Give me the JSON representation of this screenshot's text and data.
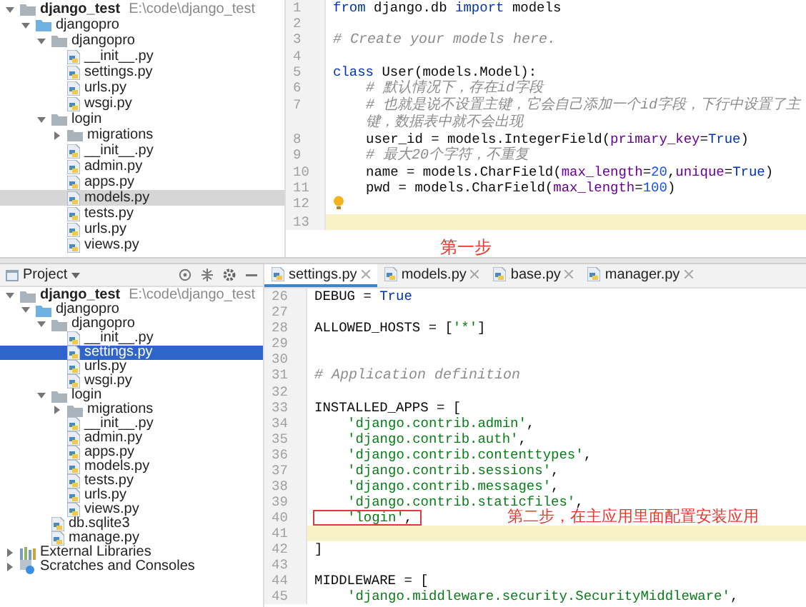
{
  "top": {
    "tree": [
      {
        "label": "django_test",
        "path": "E:\\code\\django_test",
        "kind": "root",
        "expanded": true,
        "selected": false,
        "children": [
          {
            "label": "djangopro",
            "kind": "module",
            "expanded": true,
            "selected": false,
            "children": [
              {
                "label": "djangopro",
                "kind": "folder",
                "expanded": true,
                "selected": false,
                "children": [
                  {
                    "label": "__init__.py",
                    "kind": "file",
                    "selected": false
                  },
                  {
                    "label": "settings.py",
                    "kind": "file",
                    "selected": false
                  },
                  {
                    "label": "urls.py",
                    "kind": "file",
                    "selected": false
                  },
                  {
                    "label": "wsgi.py",
                    "kind": "file",
                    "selected": false
                  }
                ]
              },
              {
                "label": "login",
                "kind": "folder",
                "expanded": true,
                "selected": false,
                "children": [
                  {
                    "label": "migrations",
                    "kind": "folder",
                    "expanded": false,
                    "selected": false
                  },
                  {
                    "label": "__init__.py",
                    "kind": "file",
                    "selected": false
                  },
                  {
                    "label": "admin.py",
                    "kind": "file",
                    "selected": false
                  },
                  {
                    "label": "apps.py",
                    "kind": "file",
                    "selected": false
                  },
                  {
                    "label": "models.py",
                    "kind": "file",
                    "selected": true
                  },
                  {
                    "label": "tests.py",
                    "kind": "file",
                    "selected": false
                  },
                  {
                    "label": "urls.py",
                    "kind": "file",
                    "selected": false
                  },
                  {
                    "label": "views.py",
                    "kind": "file",
                    "selected": false
                  }
                ]
              }
            ]
          }
        ]
      }
    ],
    "editor": {
      "lines": [
        {
          "number": "1",
          "current": false,
          "bulb": false,
          "indented": false,
          "tokens": [
            {
              "kind": "keyword",
              "text": "from"
            },
            {
              "kind": "plain",
              "text": " django.db "
            },
            {
              "kind": "keyword",
              "text": "import"
            },
            {
              "kind": "plain",
              "text": " models"
            }
          ]
        },
        {
          "number": "2",
          "current": false,
          "bulb": false
        },
        {
          "number": "3",
          "current": false,
          "bulb": false,
          "indented": false,
          "tokens": [
            {
              "kind": "comment",
              "text": "# Create your models here."
            }
          ]
        },
        {
          "number": "4",
          "current": false,
          "bulb": false
        },
        {
          "number": "5",
          "current": false,
          "bulb": false,
          "indented": false,
          "tokens": [
            {
              "kind": "keyword",
              "text": "class"
            },
            {
              "kind": "plain",
              "text": " User(models.Model):"
            }
          ]
        },
        {
          "number": "6",
          "current": false,
          "bulb": false,
          "indented": true,
          "tokens": [
            {
              "kind": "comment",
              "text": "# 默认情况下，存在id字段"
            }
          ]
        },
        {
          "number": "7",
          "current": false,
          "bulb": false,
          "indented": true,
          "tokens": [
            {
              "kind": "comment",
              "text": "# 也就是说不设置主键，它会自己添加一个id字段，下行中设置了主键，数据表中就不会出现"
            }
          ]
        },
        {
          "number": "8",
          "current": false,
          "bulb": false,
          "indented": true,
          "tokens": [
            {
              "kind": "plain",
              "text": "user_id = models.IntegerField("
            },
            {
              "kind": "param",
              "text": "primary_key"
            },
            {
              "kind": "plain",
              "text": "="
            },
            {
              "kind": "bool",
              "text": "True"
            },
            {
              "kind": "plain",
              "text": ")"
            }
          ]
        },
        {
          "number": "9",
          "current": false,
          "bulb": false,
          "indented": true,
          "tokens": [
            {
              "kind": "comment",
              "text": "# 最大20个字符，不重复"
            }
          ]
        },
        {
          "number": "10",
          "current": false,
          "bulb": false,
          "indented": true,
          "tokens": [
            {
              "kind": "plain",
              "text": "name = models.CharField("
            },
            {
              "kind": "param",
              "text": "max_length"
            },
            {
              "kind": "plain",
              "text": "="
            },
            {
              "kind": "number",
              "text": "20"
            },
            {
              "kind": "plain",
              "text": ","
            },
            {
              "kind": "param",
              "text": "unique"
            },
            {
              "kind": "plain",
              "text": "="
            },
            {
              "kind": "bool",
              "text": "True"
            },
            {
              "kind": "plain",
              "text": ")"
            }
          ]
        },
        {
          "number": "11",
          "current": false,
          "bulb": false,
          "indented": true,
          "tokens": [
            {
              "kind": "plain",
              "text": "pwd = models.CharField("
            },
            {
              "kind": "param",
              "text": "max_length"
            },
            {
              "kind": "plain",
              "text": "="
            },
            {
              "kind": "number",
              "text": "100"
            },
            {
              "kind": "plain",
              "text": ")"
            }
          ]
        },
        {
          "number": "12",
          "current": false,
          "bulb": true
        },
        {
          "number": "13",
          "current": true,
          "bulb": false
        }
      ],
      "annotation": "第一步"
    }
  },
  "bottom": {
    "panel_title": "Project",
    "tree": [
      {
        "label": "django_test",
        "path": "E:\\code\\django_test",
        "kind": "root",
        "expanded": true,
        "selected": false,
        "children": [
          {
            "label": "djangopro",
            "kind": "module",
            "expanded": true,
            "selected": false,
            "children": [
              {
                "label": "djangopro",
                "kind": "folder",
                "expanded": true,
                "selected": false,
                "children": [
                  {
                    "label": "__init__.py",
                    "kind": "file",
                    "selected": false
                  },
                  {
                    "label": "settings.py",
                    "kind": "file",
                    "selected": true
                  },
                  {
                    "label": "urls.py",
                    "kind": "file",
                    "selected": false
                  },
                  {
                    "label": "wsgi.py",
                    "kind": "file",
                    "selected": false
                  }
                ]
              },
              {
                "label": "login",
                "kind": "folder",
                "expanded": true,
                "selected": false,
                "children": [
                  {
                    "label": "migrations",
                    "kind": "folder",
                    "expanded": false,
                    "selected": false
                  },
                  {
                    "label": "__init__.py",
                    "kind": "file",
                    "selected": false
                  },
                  {
                    "label": "admin.py",
                    "kind": "file",
                    "selected": false
                  },
                  {
                    "label": "apps.py",
                    "kind": "file",
                    "selected": false
                  },
                  {
                    "label": "models.py",
                    "kind": "file",
                    "selected": false
                  },
                  {
                    "label": "tests.py",
                    "kind": "file",
                    "selected": false
                  },
                  {
                    "label": "urls.py",
                    "kind": "file",
                    "selected": false
                  },
                  {
                    "label": "views.py",
                    "kind": "file",
                    "selected": false
                  }
                ]
              },
              {
                "label": "db.sqlite3",
                "kind": "file",
                "selected": false
              },
              {
                "label": "manage.py",
                "kind": "file",
                "selected": false
              }
            ]
          }
        ]
      },
      {
        "label": "External Libraries",
        "kind": "library",
        "expanded": false,
        "selected": false
      },
      {
        "label": "Scratches and Consoles",
        "kind": "scratches",
        "expanded": false,
        "selected": false
      }
    ],
    "tabs": [
      {
        "label": "settings.py",
        "selected": true
      },
      {
        "label": "models.py",
        "selected": false
      },
      {
        "label": "base.py",
        "selected": false
      },
      {
        "label": "manager.py",
        "selected": false
      }
    ],
    "editor": {
      "lines": [
        {
          "number": "26",
          "current": false,
          "boxed": false,
          "indented": false,
          "tokens": [
            {
              "kind": "plain",
              "text": "DEBUG = "
            },
            {
              "kind": "bool",
              "text": "True"
            }
          ]
        },
        {
          "number": "27",
          "current": false,
          "boxed": false
        },
        {
          "number": "28",
          "current": false,
          "boxed": false,
          "indented": false,
          "tokens": [
            {
              "kind": "plain",
              "text": "ALLOWED_HOSTS = ["
            },
            {
              "kind": "string",
              "text": "'*'"
            },
            {
              "kind": "plain",
              "text": "]"
            }
          ]
        },
        {
          "number": "29",
          "current": false,
          "boxed": false
        },
        {
          "number": "30",
          "current": false,
          "boxed": false
        },
        {
          "number": "31",
          "current": false,
          "boxed": false,
          "indented": false,
          "tokens": [
            {
              "kind": "comment",
              "text": "# Application definition"
            }
          ]
        },
        {
          "number": "32",
          "current": false,
          "boxed": false
        },
        {
          "number": "33",
          "current": false,
          "boxed": false,
          "indented": false,
          "tokens": [
            {
              "kind": "plain",
              "text": "INSTALLED_APPS = ["
            }
          ]
        },
        {
          "number": "34",
          "current": false,
          "boxed": false,
          "indented": true,
          "tokens": [
            {
              "kind": "string",
              "text": "'django.contrib.admin'"
            },
            {
              "kind": "plain",
              "text": ","
            }
          ]
        },
        {
          "number": "35",
          "current": false,
          "boxed": false,
          "indented": true,
          "tokens": [
            {
              "kind": "string",
              "text": "'django.contrib.auth'"
            },
            {
              "kind": "plain",
              "text": ","
            }
          ]
        },
        {
          "number": "36",
          "current": false,
          "boxed": false,
          "indented": true,
          "tokens": [
            {
              "kind": "string",
              "text": "'django.contrib.contenttypes'"
            },
            {
              "kind": "plain",
              "text": ","
            }
          ]
        },
        {
          "number": "37",
          "current": false,
          "boxed": false,
          "indented": true,
          "tokens": [
            {
              "kind": "string",
              "text": "'django.contrib.sessions'"
            },
            {
              "kind": "plain",
              "text": ","
            }
          ]
        },
        {
          "number": "38",
          "current": false,
          "boxed": false,
          "indented": true,
          "tokens": [
            {
              "kind": "string",
              "text": "'django.contrib.messages'"
            },
            {
              "kind": "plain",
              "text": ","
            }
          ]
        },
        {
          "number": "39",
          "current": false,
          "boxed": false,
          "indented": true,
          "tokens": [
            {
              "kind": "string",
              "text": "'django.contrib.staticfiles'"
            },
            {
              "kind": "plain",
              "text": ","
            }
          ]
        },
        {
          "number": "40",
          "current": false,
          "boxed": true,
          "indented": true,
          "tokens": [
            {
              "kind": "string",
              "text": "'login'"
            },
            {
              "kind": "plain",
              "text": ","
            }
          ]
        },
        {
          "number": "41",
          "current": true,
          "boxed": false
        },
        {
          "number": "42",
          "current": false,
          "boxed": false,
          "indented": false,
          "tokens": [
            {
              "kind": "plain",
              "text": "]"
            }
          ]
        },
        {
          "number": "43",
          "current": false,
          "boxed": false
        },
        {
          "number": "44",
          "current": false,
          "boxed": false,
          "indented": false,
          "tokens": [
            {
              "kind": "plain",
              "text": "MIDDLEWARE = ["
            }
          ]
        },
        {
          "number": "45",
          "current": false,
          "boxed": false,
          "indented": true,
          "tokens": [
            {
              "kind": "string",
              "text": "'django.middleware.security.SecurityMiddleware'"
            },
            {
              "kind": "plain",
              "text": ","
            }
          ]
        }
      ],
      "annotation": "第二步，在主应用里面配置安装应用"
    }
  }
}
